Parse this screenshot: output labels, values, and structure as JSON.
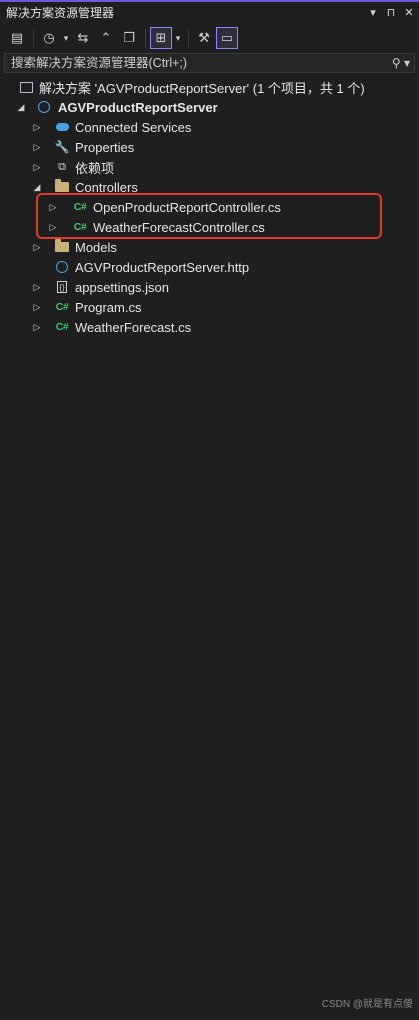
{
  "window": {
    "title": "解决方案资源管理器",
    "controls": [
      "▾",
      "⊓",
      "✕"
    ]
  },
  "toolbar": {
    "icons": [
      "vs-switch-views-icon",
      "history-icon",
      "sync-icon",
      "collapse-all-icon",
      "copy-icon",
      "show-all-files-icon",
      "properties-icon",
      "preview-icon"
    ]
  },
  "search": {
    "placeholder": "搜索解决方案资源管理器(Ctrl+;)"
  },
  "tree": {
    "solution": "解决方案 'AGVProductReportServer' (1 个项目，共 1 个)",
    "project": "AGVProductReportServer",
    "connected_services": "Connected Services",
    "properties": "Properties",
    "dependencies": "依赖项",
    "controllers": "Controllers",
    "controller_files": [
      "OpenProductReportController.cs",
      "WeatherForecastController.cs"
    ],
    "models": "Models",
    "http_file": "AGVProductReportServer.http",
    "appsettings": "appsettings.json",
    "program": "Program.cs",
    "weather_model": "WeatherForecast.cs",
    "cs_badge": "C#"
  },
  "watermark": "CSDN @就是有点傻",
  "colors": {
    "background": "#1f1f1f",
    "accent": "#6b5bd6",
    "highlight_box": "#e23a2a",
    "csharp": "#3fc46d"
  }
}
